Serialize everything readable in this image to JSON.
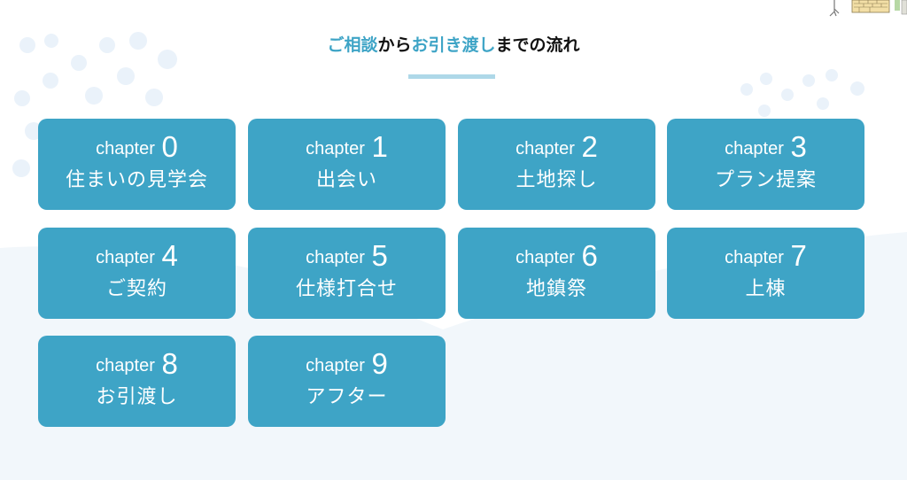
{
  "heading": {
    "parts": [
      {
        "text": "ご相談",
        "accent": true
      },
      {
        "text": "から",
        "accent": false
      },
      {
        "text": "お引き渡し",
        "accent": true
      },
      {
        "text": "までの流れ",
        "accent": false
      }
    ]
  },
  "colors": {
    "accent": "#3ea4c6",
    "tile_bg": "#3ea4c6",
    "tile_text": "#ffffff",
    "heading_dark": "#111111",
    "underline": "#aed8e8",
    "wave_bg": "#f2f7fb"
  },
  "chapters": [
    {
      "prefix": "chapter",
      "number": "0",
      "title": "住まいの見学会"
    },
    {
      "prefix": "chapter",
      "number": "1",
      "title": "出会い"
    },
    {
      "prefix": "chapter",
      "number": "2",
      "title": "土地探し"
    },
    {
      "prefix": "chapter",
      "number": "3",
      "title": "プラン提案"
    },
    {
      "prefix": "chapter",
      "number": "4",
      "title": "ご契約"
    },
    {
      "prefix": "chapter",
      "number": "5",
      "title": "仕様打合せ"
    },
    {
      "prefix": "chapter",
      "number": "6",
      "title": "地鎮祭"
    },
    {
      "prefix": "chapter",
      "number": "7",
      "title": "上棟"
    },
    {
      "prefix": "chapter",
      "number": "8",
      "title": "お引渡し"
    },
    {
      "prefix": "chapter",
      "number": "9",
      "title": "アフター"
    }
  ]
}
